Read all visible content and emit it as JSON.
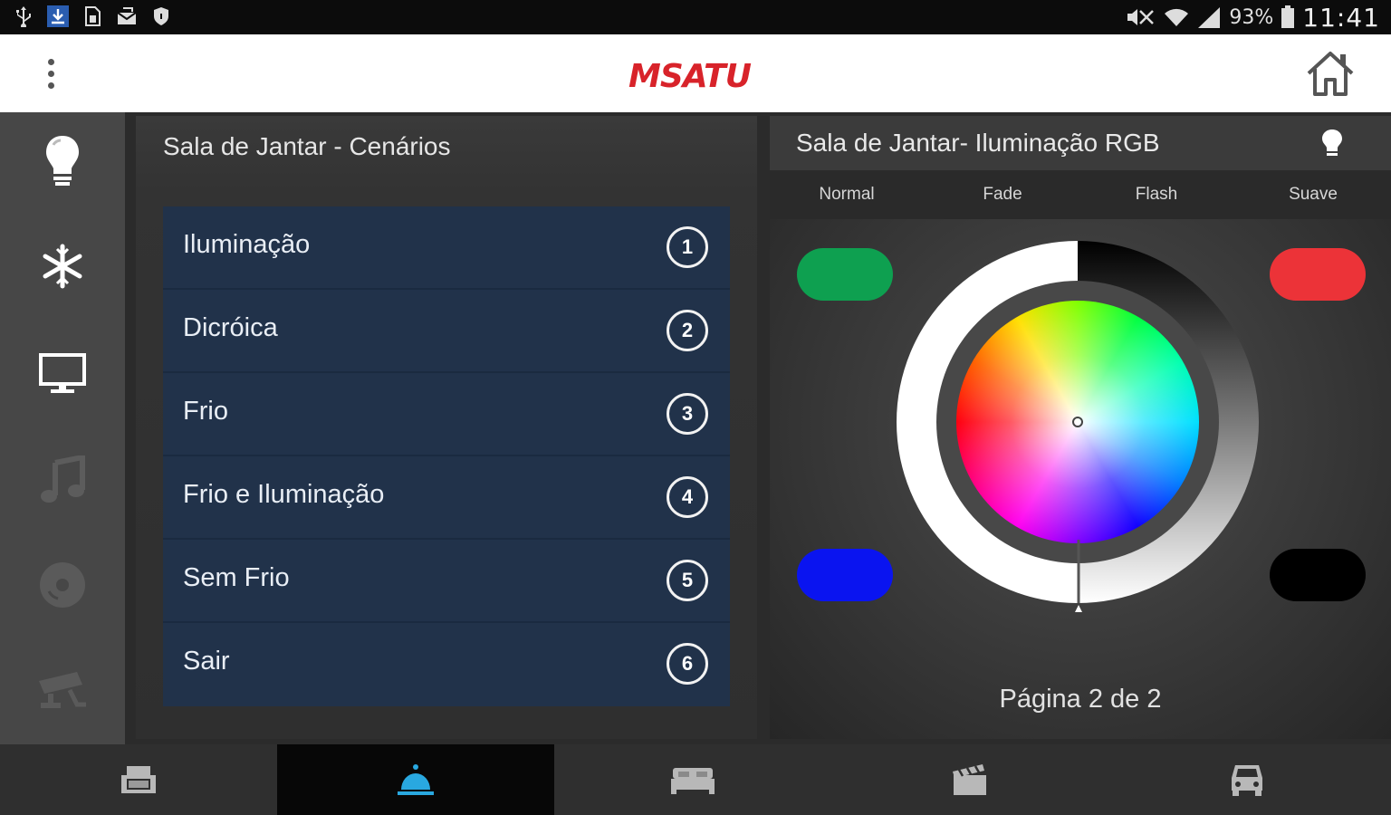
{
  "status_bar": {
    "battery_percent": "93%",
    "time": "11:41",
    "left_icons": [
      "usb-icon",
      "download-icon",
      "sim-icon",
      "mail-icon",
      "shield-icon"
    ],
    "right_icons": [
      "mute-icon",
      "wifi-icon",
      "signal-icon",
      "battery-icon"
    ]
  },
  "app_bar": {
    "logo_text": "MSATU",
    "menu_icon": "overflow-menu-icon",
    "home_icon": "home-icon"
  },
  "sidebar": {
    "items": [
      {
        "name": "lighting",
        "icon": "lightbulb-icon",
        "active": true
      },
      {
        "name": "climate",
        "icon": "snowflake-icon",
        "active": true
      },
      {
        "name": "tv",
        "icon": "monitor-icon",
        "active": true
      },
      {
        "name": "music",
        "icon": "music-note-icon",
        "active": false
      },
      {
        "name": "media",
        "icon": "disc-icon",
        "active": false
      },
      {
        "name": "camera",
        "icon": "security-camera-icon",
        "active": false
      }
    ]
  },
  "scenes_panel": {
    "title": "Sala de Jantar - Cenários",
    "items": [
      {
        "label": "Iluminação",
        "number": "1"
      },
      {
        "label": "Dicróica",
        "number": "2"
      },
      {
        "label": "Frio",
        "number": "3"
      },
      {
        "label": "Frio e Iluminação",
        "number": "4"
      },
      {
        "label": "Sem Frio",
        "number": "5"
      },
      {
        "label": "Sair",
        "number": "6"
      }
    ]
  },
  "rgb_panel": {
    "title": "Sala de Jantar- Iluminação RGB",
    "modes": [
      "Normal",
      "Fade",
      "Flash",
      "Suave"
    ],
    "swatches": [
      {
        "name": "green",
        "color": "#0ea050"
      },
      {
        "name": "red",
        "color": "#ec3338"
      },
      {
        "name": "blue",
        "color": "#0a14f0"
      },
      {
        "name": "black",
        "color": "#000000"
      }
    ],
    "page_label": "Página 2 de 2"
  },
  "bottom_nav": {
    "items": [
      {
        "name": "living-room",
        "icon": "armchair-icon",
        "active": false
      },
      {
        "name": "dining-room",
        "icon": "serving-dish-icon",
        "active": true
      },
      {
        "name": "bedroom",
        "icon": "bed-icon",
        "active": false
      },
      {
        "name": "cinema",
        "icon": "clapperboard-icon",
        "active": false
      },
      {
        "name": "garage",
        "icon": "car-icon",
        "active": false
      }
    ]
  },
  "colors": {
    "accent": "#29a8e0",
    "list_bg": "#21324a",
    "appbar": "#ffffff",
    "logo_red": "#d8232a"
  }
}
